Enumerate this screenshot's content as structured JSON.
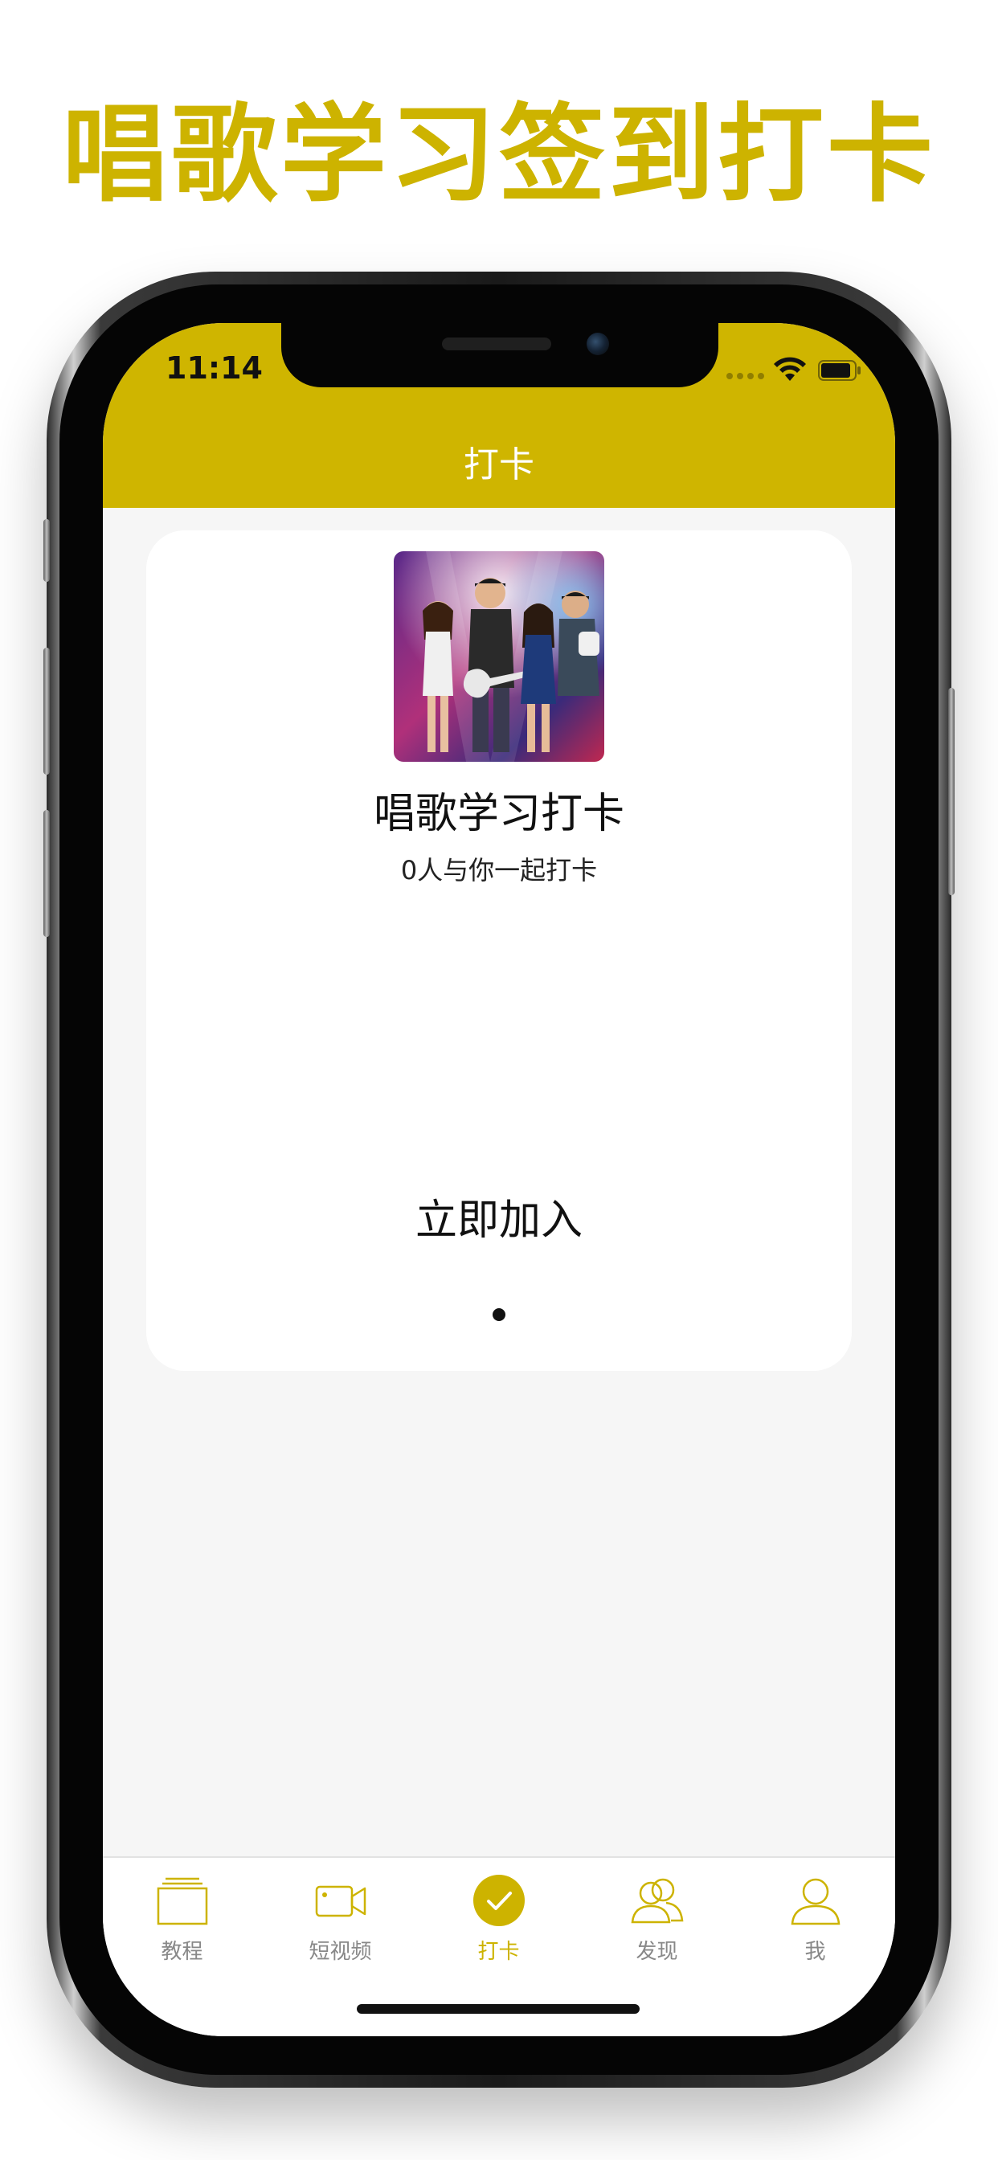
{
  "headline": "唱歌学习签到打卡",
  "status_bar": {
    "time": "11:14"
  },
  "nav": {
    "title": "打卡"
  },
  "card": {
    "title": "唱歌学习打卡",
    "subtitle": "0人与你一起打卡",
    "join_label": "立即加入",
    "page_indicator": {
      "current": 1,
      "total": 1
    }
  },
  "tabbar": {
    "items": [
      {
        "label": "教程",
        "icon": "book-icon",
        "active": false
      },
      {
        "label": "短视频",
        "icon": "video-camera-icon",
        "active": false
      },
      {
        "label": "打卡",
        "icon": "checkmark-circle-icon",
        "active": true
      },
      {
        "label": "发现",
        "icon": "people-icon",
        "active": false
      },
      {
        "label": "我",
        "icon": "person-icon",
        "active": false
      }
    ]
  },
  "colors": {
    "accent": "#cdb300",
    "header": "#cfb500",
    "background": "#f6f6f6",
    "inactive_tab": "#888888"
  }
}
